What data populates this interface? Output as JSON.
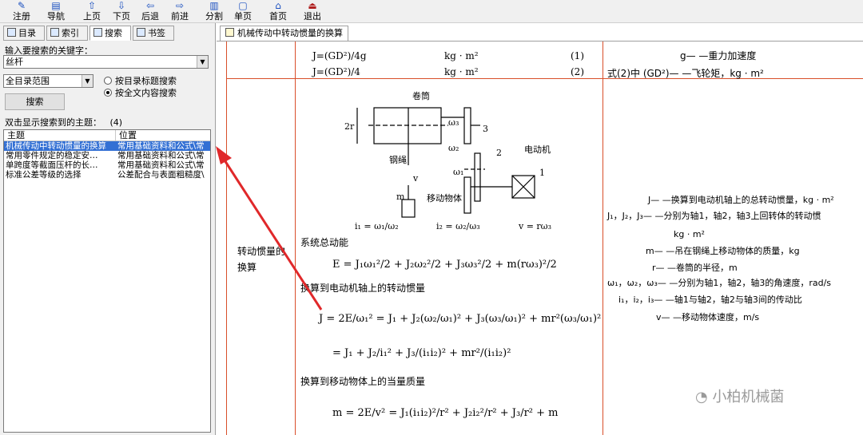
{
  "toolbar": {
    "items": [
      {
        "label": "注册",
        "icon": "register-icon"
      },
      {
        "label": "导航",
        "icon": "navigate-icon"
      },
      {
        "label": "上页",
        "icon": "arrow-up-icon"
      },
      {
        "label": "下页",
        "icon": "arrow-down-icon"
      },
      {
        "label": "后退",
        "icon": "arrow-left-icon"
      },
      {
        "label": "前进",
        "icon": "arrow-right-icon"
      },
      {
        "label": "分割",
        "icon": "split-icon"
      },
      {
        "label": "单页",
        "icon": "single-page-icon"
      },
      {
        "label": "首页",
        "icon": "home-icon"
      },
      {
        "label": "退出",
        "icon": "exit-icon"
      }
    ]
  },
  "left_panel": {
    "tabs": [
      "目录",
      "索引",
      "搜索",
      "书签"
    ],
    "active_tab": "搜索",
    "keyword_label": "输入要搜索的关键字：",
    "keyword_value": "丝杆",
    "range_value": "全目录范围",
    "radio_title": "按目录标题搜索",
    "radio_fulltext": "按全文内容搜索",
    "search_button": "搜索",
    "result_count_label": "双击显示搜索到的主题：",
    "result_count": "(4)",
    "columns": [
      "主题",
      "位置"
    ],
    "results": [
      {
        "topic": "机械传动中转动惯量的换算",
        "location": "常用基础资料和公式\\常",
        "selected": true
      },
      {
        "topic": "常用零件规定的稳定安…",
        "location": "常用基础资料和公式\\常",
        "selected": false
      },
      {
        "topic": "单跨度等截面压杆的长…",
        "location": "常用基础资料和公式\\常",
        "selected": false
      },
      {
        "topic": "标准公差等级的选择",
        "location": "公差配合与表面粗糙度\\",
        "selected": false
      }
    ]
  },
  "doc": {
    "tab_title": "机械传动中转动惯量的换算",
    "top_row": {
      "eq1": "J=(GD²)/4g",
      "eq1_unit": "kg · m²",
      "eq1_num": "(1)",
      "eq2": "J=(GD²)/4",
      "eq2_unit": "kg · m²",
      "eq2_num": "(2)",
      "note1": "g— —重力加速度",
      "note2": "式(2)中  (GD²)— —飞轮矩，kg · m²"
    },
    "row_label": "转动惯量的换算",
    "diagram": {
      "drum": "卷筒",
      "rope": "钢绳",
      "motor": "电动机",
      "moving": "移动物体",
      "omega3": "ω₃",
      "omega2": "ω₂",
      "omega1": "ω₁",
      "n3": "3",
      "n2": "2",
      "n1": "1",
      "m": "m",
      "v": "v",
      "r2": "2r"
    },
    "ratios": {
      "i1": "i₁ = ω₁/ω₂",
      "i2": "i₂ = ω₂/ω₃",
      "v": "v = rω₃"
    },
    "ke_title": "系统总动能",
    "ke_eq": "E = J₁ω₁²/2 + J₂ω₂²/2 + J₃ω₃²/2 + m(rω₃)²/2",
    "motor_title": "换算到电动机轴上的转动惯量",
    "motor_eq1": "J = 2E/ω₁² = J₁ + J₂(ω₂/ω₁)² + J₃(ω₃/ω₁)² + mr²(ω₃/ω₁)²",
    "motor_eq2": "= J₁ + J₂/i₁² + J₃/(i₁i₂)² + mr²/(i₁i₂)²",
    "mass_title": "换算到移动物体上的当量质量",
    "mass_eq": "m = 2E/v² = J₁(i₁i₂)²/r² + J₂i₂²/r² + J₃/r² + m",
    "legend": [
      "J— —换算到电动机轴上的总转动惯量，kg · m²",
      "J₁，J₂，J₃— —分别为轴1，轴2，轴3上回转体的转动惯",
      "kg · m²",
      "m— —吊在钢绳上移动物体的质量，kg",
      "r— —卷筒的半径，m",
      "ω₁，ω₂，ω₃— —分别为轴1，轴2，轴3的角速度，rad/s",
      "i₁，i₂，i₃— —轴1与轴2，轴2与轴3间的传动比",
      "v— —移动物体速度，m/s"
    ]
  },
  "watermark": "小柏机械菌",
  "colors": {
    "selection": "#3370d4",
    "table_line": "#d94f2a",
    "arrow": "#e0282a"
  }
}
